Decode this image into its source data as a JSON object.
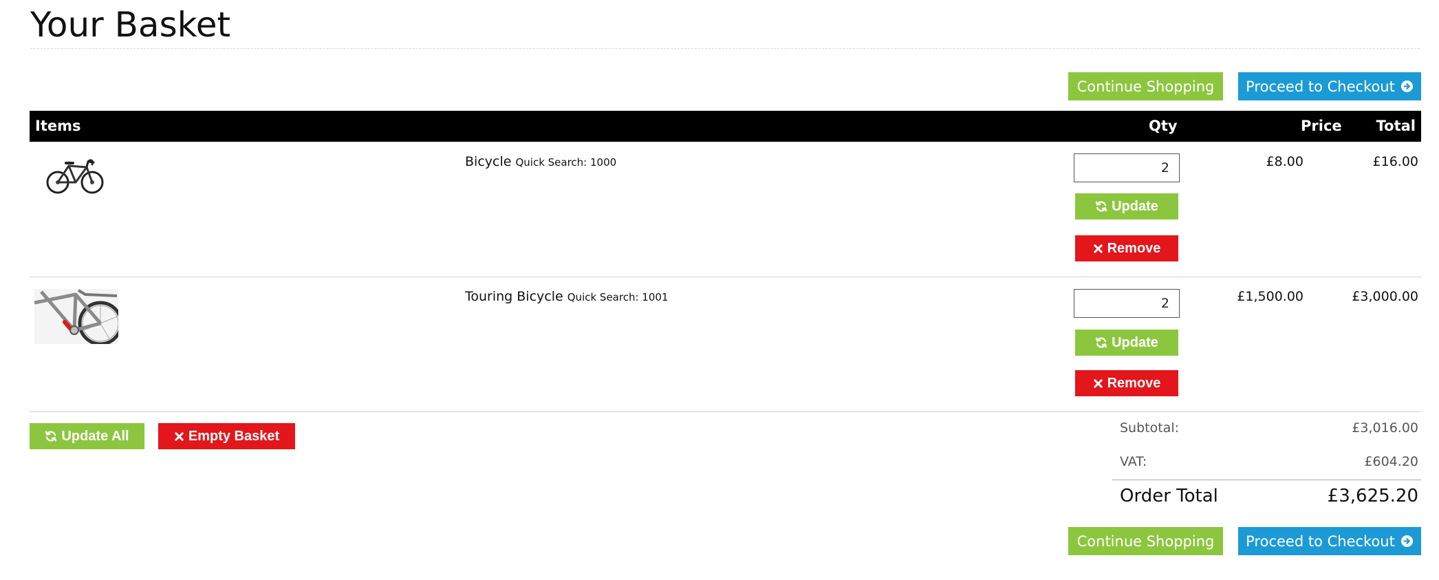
{
  "page": {
    "title": "Your Basket"
  },
  "actions": {
    "continue_shopping": "Continue Shopping",
    "proceed_to_checkout": "Proceed to Checkout",
    "update_all": "Update All",
    "empty_basket": "Empty Basket"
  },
  "table": {
    "headers": {
      "items": "Items",
      "qty": "Qty",
      "price": "Price",
      "total": "Total"
    },
    "rows": [
      {
        "name": "Bicycle",
        "quick_search": "Quick Search: 1000",
        "qty": "2",
        "price": "£8.00",
        "total": "£16.00",
        "update_label": "Update",
        "remove_label": "Remove",
        "image_icon": "road-bicycle-image"
      },
      {
        "name": "Touring Bicycle",
        "quick_search": "Quick Search: 1001",
        "qty": "2",
        "price": "£1,500.00",
        "total": "£3,000.00",
        "update_label": "Update",
        "remove_label": "Remove",
        "image_icon": "touring-bicycle-image"
      }
    ]
  },
  "summary": {
    "subtotal_label": "Subtotal:",
    "subtotal_value": "£3,016.00",
    "vat_label": "VAT:",
    "vat_value": "£604.20",
    "order_total_label": "Order Total",
    "order_total_value": "£3,625.20"
  },
  "colors": {
    "green": "#8cc63f",
    "blue": "#1b9ad6",
    "red": "#e3161c",
    "header_bg": "#000000"
  },
  "icons": {
    "refresh": "refresh-icon",
    "remove": "times-icon",
    "checkout": "arrow-circle-right-icon"
  }
}
